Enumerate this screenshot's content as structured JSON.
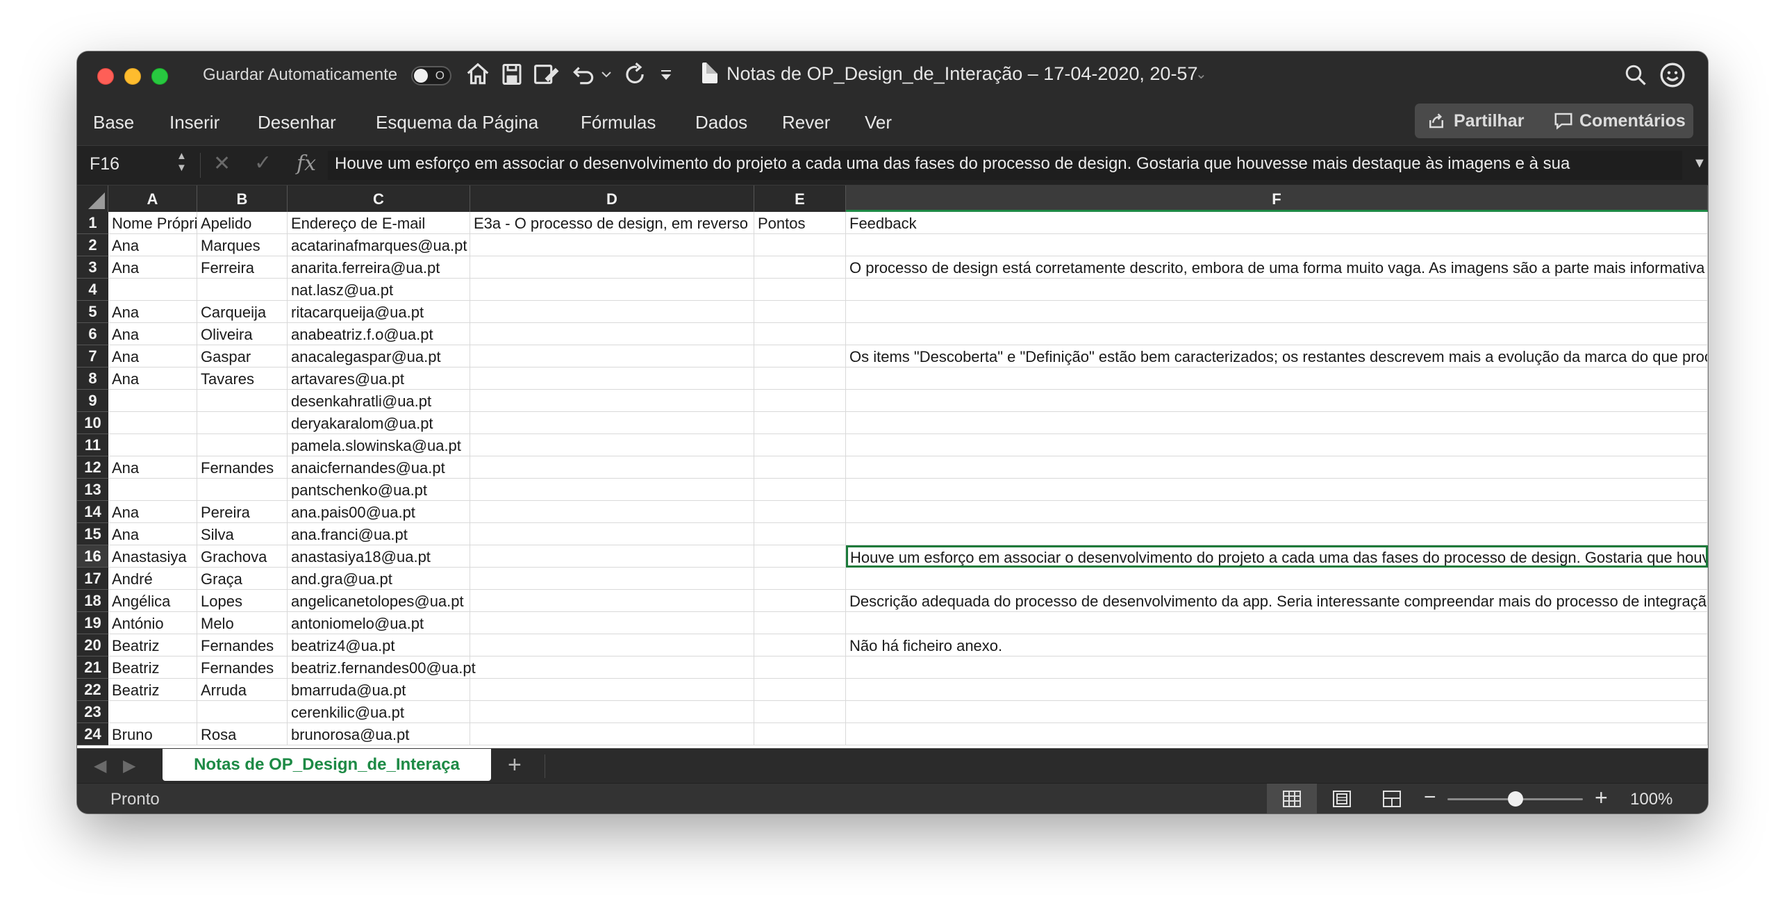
{
  "titlebar": {
    "autosave_label": "Guardar Automaticamente",
    "autosave_toggle_state": "O",
    "document_title": "Notas de OP_Design_de_Interação – 17-04-2020, 20-57"
  },
  "ribbon": {
    "tabs": [
      "Base",
      "Inserir",
      "Desenhar",
      "Esquema da Página",
      "Fórmulas",
      "Dados",
      "Rever",
      "Ver"
    ],
    "share_label": "Partilhar",
    "comments_label": "Comentários"
  },
  "formula_bar": {
    "cell_ref": "F16",
    "fx_label": "fx",
    "content": "Houve um esforço em associar o desenvolvimento do projeto a cada uma das fases do processo de design. Gostaria que houvesse mais destaque às imagens e à sua"
  },
  "grid": {
    "columns": [
      "A",
      "B",
      "C",
      "D",
      "E",
      "F"
    ],
    "selected_column": "F",
    "selected_row": "16",
    "rows": [
      {
        "num": "1",
        "cells": [
          "Nome Própri",
          "Apelido",
          "Endereço de E-mail",
          "E3a - O processo de design, em reverso",
          "Pontos",
          "Feedback"
        ]
      },
      {
        "num": "2",
        "cells": [
          "Ana",
          "Marques",
          "acatarinafmarques@ua.pt",
          "",
          "",
          ""
        ]
      },
      {
        "num": "3",
        "cells": [
          "Ana",
          "Ferreira",
          "anarita.ferreira@ua.pt",
          "",
          "",
          "O processo de design está corretamente descrito, embora de uma forma muito vaga. As imagens  são a parte mais informativa"
        ]
      },
      {
        "num": "4",
        "cells": [
          "",
          "",
          "nat.lasz@ua.pt",
          "",
          "",
          ""
        ]
      },
      {
        "num": "5",
        "cells": [
          "Ana",
          "Carqueija",
          "ritacarqueija@ua.pt",
          "",
          "",
          ""
        ]
      },
      {
        "num": "6",
        "cells": [
          "Ana",
          "Oliveira",
          "anabeatriz.f.o@ua.pt",
          "",
          "",
          ""
        ]
      },
      {
        "num": "7",
        "cells": [
          "Ana",
          "Gaspar",
          "anacalegaspar@ua.pt",
          "",
          "",
          "Os items \"Descoberta\" e \"Definição\" estão bem caracterizados; os restantes descrevem mais a evolução da marca do que proc"
        ]
      },
      {
        "num": "8",
        "cells": [
          "Ana",
          "Tavares",
          "artavares@ua.pt",
          "",
          "",
          ""
        ]
      },
      {
        "num": "9",
        "cells": [
          "",
          "",
          "desenkahratli@ua.pt",
          "",
          "",
          ""
        ]
      },
      {
        "num": "10",
        "cells": [
          "",
          "",
          "deryakaralom@ua.pt",
          "",
          "",
          ""
        ]
      },
      {
        "num": "11",
        "cells": [
          "",
          "",
          "pamela.slowinska@ua.pt",
          "",
          "",
          ""
        ]
      },
      {
        "num": "12",
        "cells": [
          "Ana",
          "Fernandes",
          "anaicfernandes@ua.pt",
          "",
          "",
          ""
        ]
      },
      {
        "num": "13",
        "cells": [
          "",
          "",
          "pantschenko@ua.pt",
          "",
          "",
          ""
        ]
      },
      {
        "num": "14",
        "cells": [
          "Ana",
          "Pereira",
          "ana.pais00@ua.pt",
          "",
          "",
          ""
        ]
      },
      {
        "num": "15",
        "cells": [
          "Ana",
          "Silva",
          "ana.franci@ua.pt",
          "",
          "",
          ""
        ]
      },
      {
        "num": "16",
        "cells": [
          "Anastasiya",
          "Grachova",
          "anastasiya18@ua.pt",
          "",
          "",
          "Houve um esforço em associar o desenvolvimento do projeto a cada uma das fases do processo de design. Gostaria que houvesse"
        ]
      },
      {
        "num": "17",
        "cells": [
          "André",
          "Graça",
          "and.gra@ua.pt",
          "",
          "",
          ""
        ]
      },
      {
        "num": "18",
        "cells": [
          "Angélica",
          "Lopes",
          "angelicanetolopes@ua.pt",
          "",
          "",
          "Descrição adequada do processo de desenvolvimento da app. Seria interessante compreendar mais do processo de integração"
        ]
      },
      {
        "num": "19",
        "cells": [
          "António",
          "Melo",
          "antoniomelo@ua.pt",
          "",
          "",
          ""
        ]
      },
      {
        "num": "20",
        "cells": [
          "Beatriz",
          "Fernandes",
          "beatriz4@ua.pt",
          "",
          "",
          "Não há ficheiro anexo."
        ]
      },
      {
        "num": "21",
        "cells": [
          "Beatriz",
          "Fernandes",
          "beatriz.fernandes00@ua.pt",
          "",
          "",
          ""
        ]
      },
      {
        "num": "22",
        "cells": [
          "Beatriz",
          "Arruda",
          "bmarruda@ua.pt",
          "",
          "",
          ""
        ]
      },
      {
        "num": "23",
        "cells": [
          "",
          "",
          "cerenkilic@ua.pt",
          "",
          "",
          ""
        ]
      },
      {
        "num": "24",
        "cells": [
          "Bruno",
          "Rosa",
          "brunorosa@ua.pt",
          "",
          "",
          ""
        ]
      }
    ]
  },
  "sheet_tabs": {
    "active": "Notas de OP_Design_de_Interaça",
    "add_label": "+"
  },
  "status_bar": {
    "status": "Pronto",
    "zoom": "100%",
    "zoom_fraction": 0.5
  },
  "colors": {
    "accent_green": "#1d8a45",
    "close": "#fe5f57",
    "minimize": "#febc2e",
    "maximize": "#28c840"
  }
}
